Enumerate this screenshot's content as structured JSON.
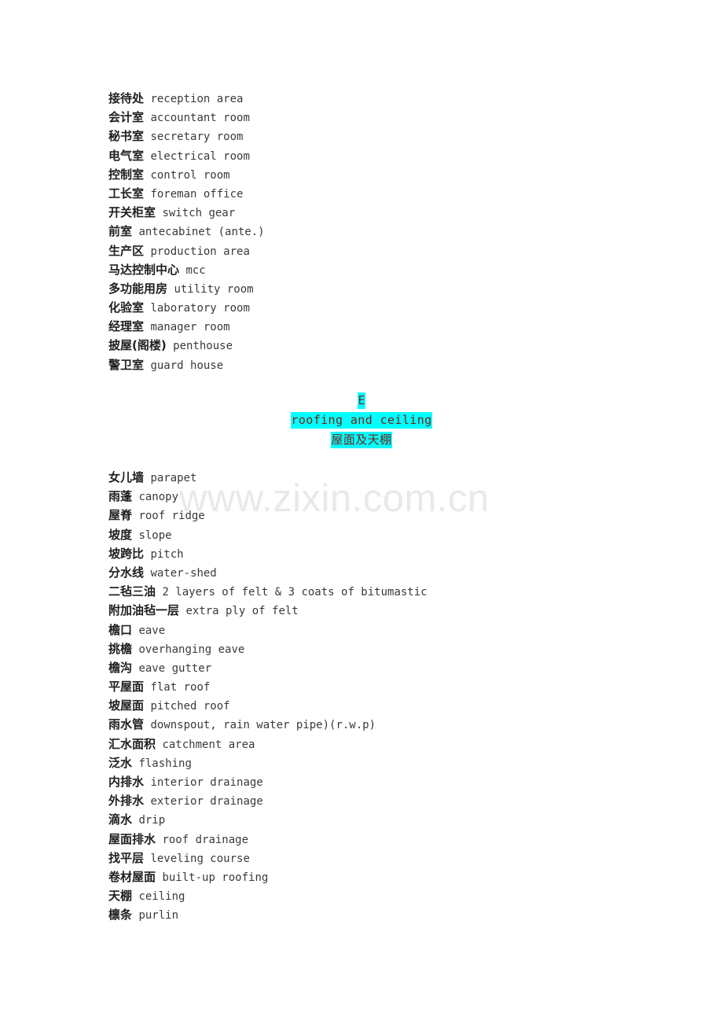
{
  "document": {
    "background_color": "#ffffff",
    "body_text_color": "#2c2c2c"
  },
  "watermark": {
    "text": "www.zixin.com.cn",
    "color": "#e9e9e9"
  },
  "sections": [
    {
      "id": "rooms",
      "entries": [
        {
          "cn": "接待处",
          "en": "reception area"
        },
        {
          "cn": "会计室",
          "en": "accountant room"
        },
        {
          "cn": "秘书室",
          "en": "secretary room"
        },
        {
          "cn": "电气室",
          "en": "electrical room"
        },
        {
          "cn": "控制室",
          "en": "control room"
        },
        {
          "cn": "工长室",
          "en": "foreman office"
        },
        {
          "cn": "开关柜室",
          "en": "switch gear"
        },
        {
          "cn": "前室",
          "en": "antecabinet (ante.)"
        },
        {
          "cn": "生产区",
          "en": "production area"
        },
        {
          "cn": "马达控制中心",
          "en": "mcc"
        },
        {
          "cn": "多功能用房",
          "en": "utility room"
        },
        {
          "cn": "化验室",
          "en": "laboratory room"
        },
        {
          "cn": "经理室",
          "en": "manager room"
        },
        {
          "cn": "披屋(阁楼)",
          "en": "penthouse"
        },
        {
          "cn": "警卫室",
          "en": "guard house"
        }
      ]
    },
    {
      "id": "roofing-and-ceiling",
      "entries": [
        {
          "cn": "女儿墙",
          "en": "parapet"
        },
        {
          "cn": "雨蓬",
          "en": "canopy"
        },
        {
          "cn": "屋脊",
          "en": "roof ridge"
        },
        {
          "cn": "坡度",
          "en": "slope"
        },
        {
          "cn": "坡跨比",
          "en": "pitch"
        },
        {
          "cn": "分水线",
          "en": "water-shed"
        },
        {
          "cn": "二毡三油",
          "en": "2 layers of felt & 3 coats of bitumastic"
        },
        {
          "cn": "附加油毡一层",
          "en": "extra ply of felt"
        },
        {
          "cn": "檐口",
          "en": "eave"
        },
        {
          "cn": "挑檐",
          "en": "overhanging eave"
        },
        {
          "cn": "檐沟",
          "en": "eave gutter"
        },
        {
          "cn": "平屋面",
          "en": "flat roof"
        },
        {
          "cn": "坡屋面",
          "en": "pitched roof"
        },
        {
          "cn": "雨水管",
          "en": "downspout, rain water pipe)(r.w.p)"
        },
        {
          "cn": "汇水面积",
          "en": "catchment area"
        },
        {
          "cn": "泛水",
          "en": "flashing"
        },
        {
          "cn": "内排水",
          "en": "interior drainage"
        },
        {
          "cn": "外排水",
          "en": "exterior drainage"
        },
        {
          "cn": "滴水",
          "en": "drip"
        },
        {
          "cn": "屋面排水",
          "en": "roof drainage"
        },
        {
          "cn": "找平层",
          "en": "leveling course"
        },
        {
          "cn": "卷材屋面",
          "en": "built-up roofing"
        },
        {
          "cn": "天棚",
          "en": "ceiling"
        },
        {
          "cn": "檩条",
          "en": "purlin"
        }
      ]
    }
  ],
  "heading": {
    "letter": "E",
    "english": "roofing and ceiling",
    "chinese": "屋面及天棚",
    "highlight_color": "#00ffff",
    "text_color": "#7a1f14"
  }
}
